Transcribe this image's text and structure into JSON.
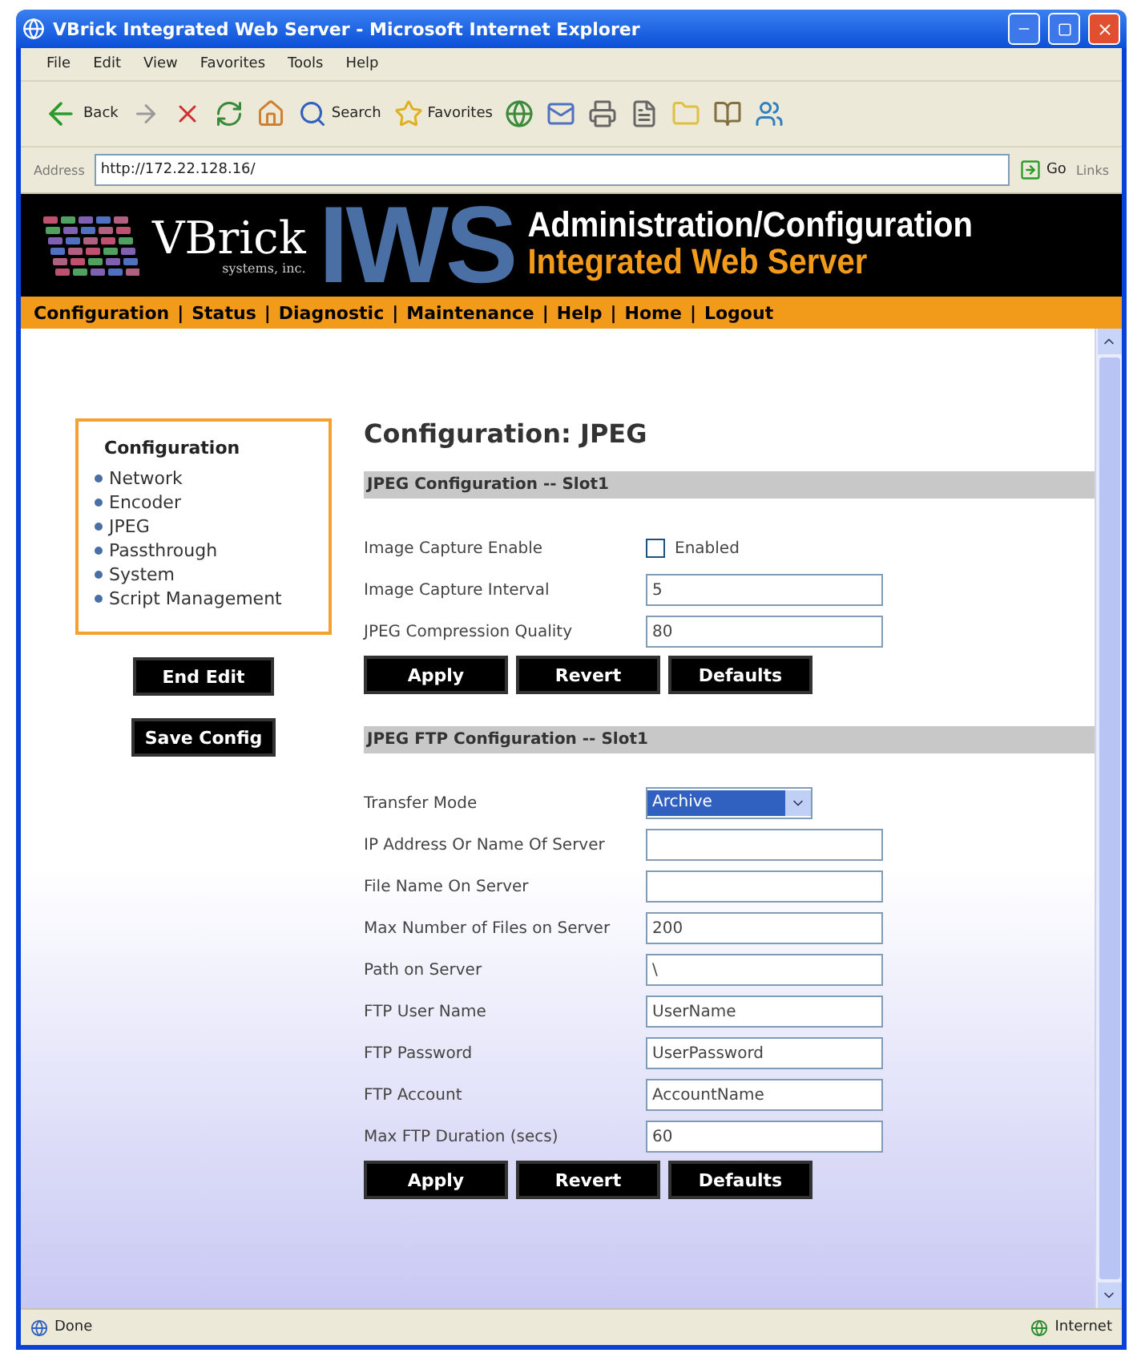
{
  "window": {
    "title": "VBrick Integrated Web Server - Microsoft Internet Explorer"
  },
  "menu": [
    "File",
    "Edit",
    "View",
    "Favorites",
    "Tools",
    "Help"
  ],
  "toolbar": [
    {
      "kind": "back",
      "label": "Back"
    },
    {
      "kind": "forward"
    },
    {
      "kind": "stop"
    },
    {
      "kind": "refresh"
    },
    {
      "kind": "home"
    },
    {
      "kind": "search",
      "label": "Search"
    },
    {
      "kind": "favorites",
      "label": "Favorites"
    },
    {
      "kind": "media"
    },
    {
      "kind": "mail"
    },
    {
      "kind": "print"
    },
    {
      "kind": "edit"
    },
    {
      "kind": "folder"
    },
    {
      "kind": "research"
    },
    {
      "kind": "messenger"
    }
  ],
  "address": {
    "label": "Address",
    "value": "http://172.22.128.16/",
    "go": "Go",
    "links": "Links"
  },
  "banner": {
    "logo": "VBrick",
    "logo_sub": "systems, inc.",
    "mark": "IWS",
    "heading": "Administration/Configuration",
    "subheading": "Integrated Web Server"
  },
  "nav": {
    "separator": "|",
    "items": [
      "Configuration",
      "Status",
      "Diagnostic",
      "Maintenance",
      "Help",
      "Home",
      "Logout"
    ]
  },
  "sidebar": {
    "title": "Configuration",
    "items": [
      "Network",
      "Encoder",
      "JPEG",
      "Passthrough",
      "System",
      "Script Management"
    ],
    "buttons": [
      "End Edit",
      "Save Config"
    ]
  },
  "main": {
    "title": "Configuration: JPEG",
    "sections": [
      {
        "heading": "JPEG Configuration -- Slot1",
        "fields": [
          {
            "kind": "checkbox",
            "label": "Image Capture Enable",
            "option": "Enabled",
            "checked": false
          },
          {
            "kind": "text",
            "label": "Image Capture Interval",
            "value": "5"
          },
          {
            "kind": "text",
            "label": "JPEG Compression Quality",
            "value": "80"
          }
        ],
        "buttons": [
          "Apply",
          "Revert",
          "Defaults"
        ]
      },
      {
        "heading": "JPEG FTP Configuration -- Slot1",
        "fields": [
          {
            "kind": "select",
            "label": "Transfer Mode",
            "value": "Archive"
          },
          {
            "kind": "text",
            "label": "IP Address Or Name Of Server"
          },
          {
            "kind": "text",
            "label": "File Name On Server"
          },
          {
            "kind": "text",
            "label": "Max Number of Files on Server",
            "value": "200"
          },
          {
            "kind": "text",
            "label": "Path on Server",
            "value": "\\"
          },
          {
            "kind": "text",
            "label": "FTP User Name",
            "value": "UserName"
          },
          {
            "kind": "text",
            "label": "FTP Password",
            "value": "UserPassword"
          },
          {
            "kind": "text",
            "label": "FTP Account",
            "value": "AccountName"
          },
          {
            "kind": "text",
            "label": "Max FTP Duration (secs)",
            "value": "60"
          }
        ],
        "buttons": [
          "Apply",
          "Revert",
          "Defaults"
        ]
      }
    ]
  },
  "status_bar": {
    "left": "Done",
    "zone": "Internet"
  }
}
